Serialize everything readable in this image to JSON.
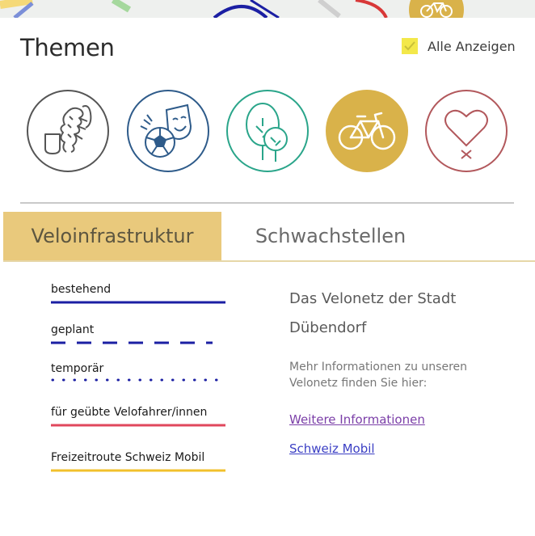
{
  "panel": {
    "title": "Themen",
    "show_all_label": "Alle Anzeigen",
    "show_all_checked": true
  },
  "themes": [
    {
      "name": "history",
      "icon": "heraldic-lion-icon",
      "color": "#555555",
      "selected": false
    },
    {
      "name": "leisure",
      "icon": "football-theater-mask-icon",
      "color": "#2e5b8a",
      "selected": false
    },
    {
      "name": "nature",
      "icon": "trees-icon",
      "color": "#2aa58a",
      "selected": false
    },
    {
      "name": "bicycle",
      "icon": "bicycle-icon",
      "color": "#d9b24a",
      "selected": true
    },
    {
      "name": "health",
      "icon": "heart-icon",
      "color": "#b2585c",
      "selected": false
    }
  ],
  "tabs": {
    "active": "Veloinfrastruktur",
    "inactive": "Schwachstellen"
  },
  "legend": [
    {
      "label": "bestehend",
      "style": "solid",
      "color": "#1b1fa3"
    },
    {
      "label": "geplant",
      "style": "dashed",
      "color": "#1b1fa3"
    },
    {
      "label": "temporär",
      "style": "dotted",
      "color": "#1b1fa3"
    },
    {
      "label": "für geübte Velofahrer/innen",
      "style": "solid",
      "color": "#e0475c"
    },
    {
      "label": "Freizeitroute Schweiz Mobil",
      "style": "solid",
      "color": "#f2c02c"
    }
  ],
  "info": {
    "title": "Das Velonetz der Stadt Dübendorf",
    "text": "Mehr Informationen zu unseren Velonetz finden Sie hier:",
    "link_more": "Weitere Informationen",
    "link_mobil": "Schweiz Mobil"
  },
  "colors": {
    "accent": "#e9c97c",
    "checkbox": "#f3e84a"
  }
}
